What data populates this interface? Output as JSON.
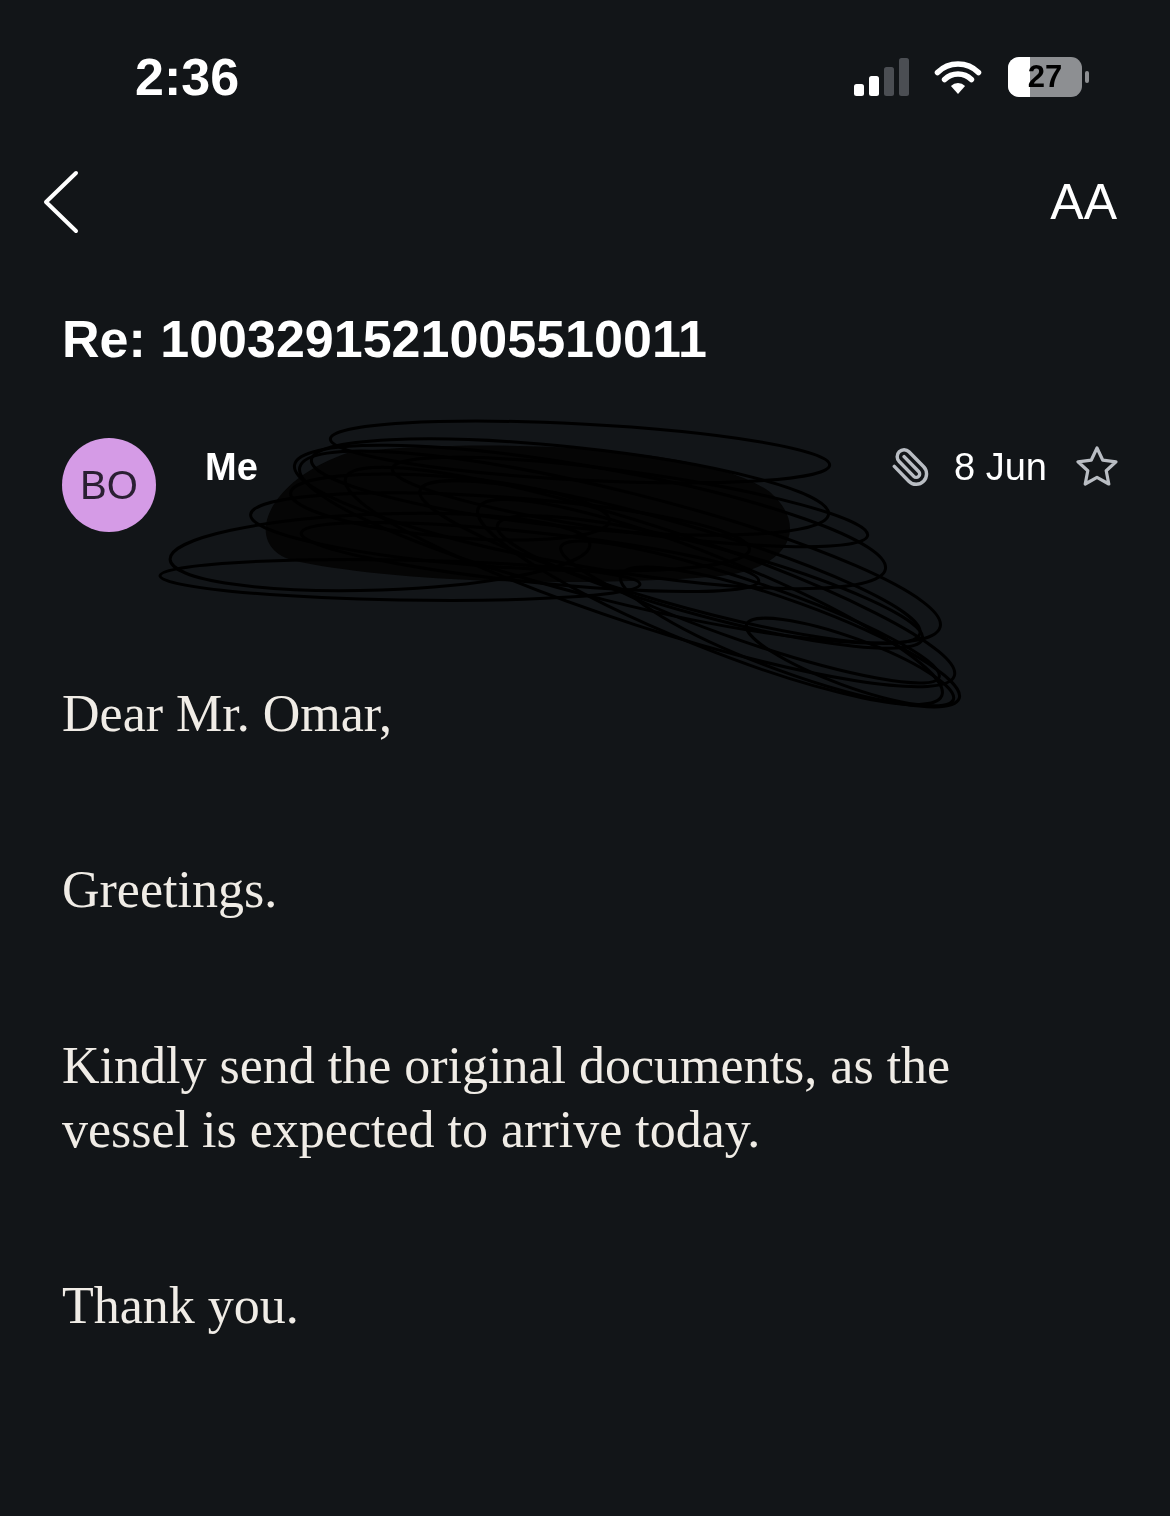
{
  "status_bar": {
    "time": "2:36",
    "battery": "27"
  },
  "nav": {
    "text_size_button": "AA"
  },
  "subject": "Re: 1003291521005510011",
  "message": {
    "avatar_initials": "BO",
    "sender": "Me",
    "has_attachment": true,
    "date": "8 Jun",
    "starred": false
  },
  "body": [
    "Dear Mr. Omar,",
    "Greetings.",
    "Kindly send the original documents, as the vessel is expected to arrive today.",
    "Thank you."
  ]
}
